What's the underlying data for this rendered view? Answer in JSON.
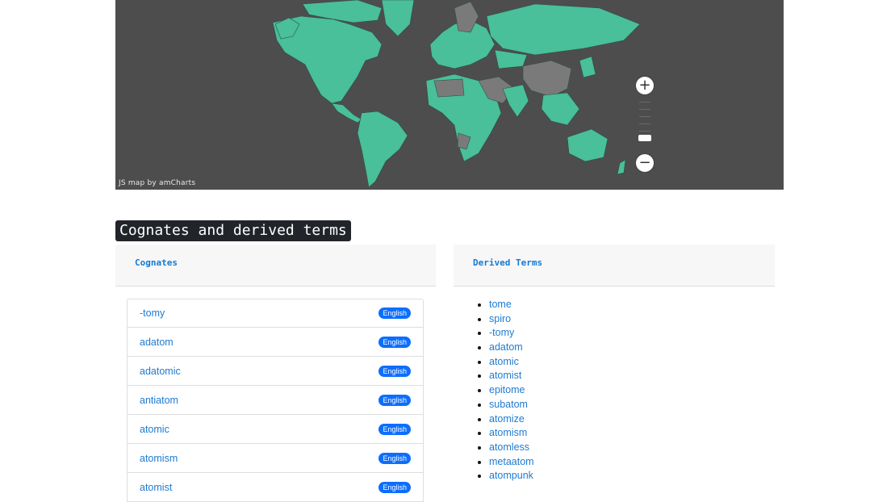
{
  "map": {
    "credit": "JS map by amCharts",
    "colors": {
      "background": "#4d4d4d",
      "highlight": "#49bf9a",
      "other": "#7a7a7a",
      "border": "#2f4f45"
    },
    "zoom": {
      "in_symbol": "+",
      "out_symbol": "−"
    }
  },
  "section": {
    "title": "Cognates and derived terms"
  },
  "cognates": {
    "header": "Cognates",
    "items": [
      {
        "word": "-tomy",
        "lang": "English"
      },
      {
        "word": "adatom",
        "lang": "English"
      },
      {
        "word": "adatomic",
        "lang": "English"
      },
      {
        "word": "antiatom",
        "lang": "English"
      },
      {
        "word": "atomic",
        "lang": "English"
      },
      {
        "word": "atomism",
        "lang": "English"
      },
      {
        "word": "atomist",
        "lang": "English"
      }
    ]
  },
  "derived": {
    "header": "Derived Terms",
    "items": [
      "tome",
      "spiro",
      "-tomy",
      "adatom",
      "atomic",
      "atomist",
      "epitome",
      "subatom",
      "atomize",
      "atomism",
      "atomless",
      "metaatom",
      "atompunk"
    ]
  }
}
